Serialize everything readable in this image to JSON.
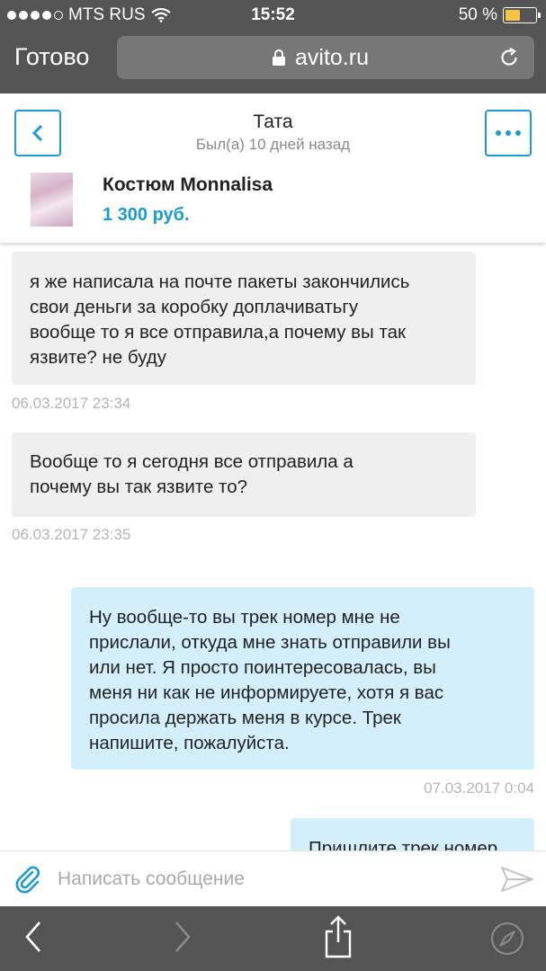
{
  "status_bar": {
    "carrier": "MTS RUS",
    "time": "15:52",
    "battery": "50 %"
  },
  "safari": {
    "done_label": "Готово",
    "url": "avito.ru"
  },
  "chat_header": {
    "name": "Тата",
    "last_seen": "Был(а) 10 дней назад",
    "item_title": "Костюм Monnalisa",
    "item_price": "1 300 руб."
  },
  "messages": [
    {
      "direction": "incoming",
      "lines": [
        "я же написала на почте пакеты закончились",
        "свои деньги за коробку доплачиватьгу",
        "вообще то я все отправила,а почему вы так",
        "язвите? не буду"
      ],
      "time": "06.03.2017 23:34"
    },
    {
      "direction": "incoming",
      "lines": [
        "Вообще то я сегодня все отправила а",
        "почему вы так язвите то?"
      ],
      "time": "06.03.2017 23:35"
    },
    {
      "direction": "outgoing",
      "lines": [
        "Ну вообще-то вы трек номер мне не",
        "прислали, откуда мне знать отправили вы",
        "или нет. Я просто поинтересовалась, вы",
        "меня ни как не информируете, хотя я вас",
        "просила держать меня в курсе. Трек",
        "напишите, пожалуйста."
      ],
      "time": "07.03.2017 0:04"
    },
    {
      "direction": "outgoing",
      "lines": [
        "Пришлите трек номер"
      ]
    }
  ],
  "input": {
    "placeholder": "Написать сообщение"
  },
  "colors": {
    "accent": "#1a9ad6",
    "incoming_bubble": "#efefef",
    "outgoing_bubble": "#d4effc",
    "safari_chrome": "#545454"
  }
}
